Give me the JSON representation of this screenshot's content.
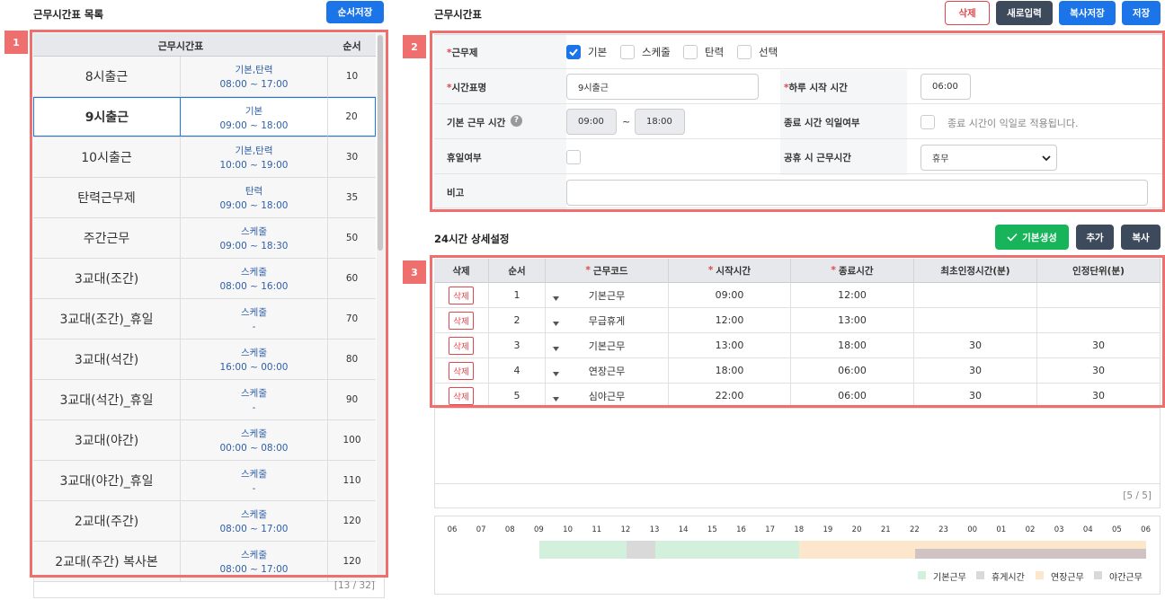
{
  "left": {
    "title": "근무시간표 목록",
    "order_save": "순서저장",
    "badge": "1",
    "headers": {
      "name": "근무시간표",
      "order": "순서"
    },
    "rows": [
      {
        "name": "8시출근",
        "type": "기본,탄력",
        "time": "08:00 ~ 17:00",
        "order": "10"
      },
      {
        "name": "9시출근",
        "type": "기본",
        "time": "09:00 ~ 18:00",
        "order": "20"
      },
      {
        "name": "10시출근",
        "type": "기본,탄력",
        "time": "10:00 ~ 19:00",
        "order": "30"
      },
      {
        "name": "탄력근무제",
        "type": "탄력",
        "time": "09:00 ~ 18:00",
        "order": "35"
      },
      {
        "name": "주간근무",
        "type": "스케줄",
        "time": "09:00 ~ 18:30",
        "order": "50"
      },
      {
        "name": "3교대(조간)",
        "type": "스케줄",
        "time": "08:00 ~ 16:00",
        "order": "60"
      },
      {
        "name": "3교대(조간)_휴일",
        "type": "스케줄",
        "time": "-",
        "order": "70"
      },
      {
        "name": "3교대(석간)",
        "type": "스케줄",
        "time": "16:00 ~ 00:00",
        "order": "80"
      },
      {
        "name": "3교대(석간)_휴일",
        "type": "스케줄",
        "time": "-",
        "order": "90"
      },
      {
        "name": "3교대(야간)",
        "type": "스케줄",
        "time": "00:00 ~ 08:00",
        "order": "100"
      },
      {
        "name": "3교대(야간)_휴일",
        "type": "스케줄",
        "time": "-",
        "order": "110"
      },
      {
        "name": "2교대(주간)",
        "type": "스케줄",
        "time": "08:00 ~ 17:00",
        "order": "120"
      },
      {
        "name": "2교대(주간) 복사본",
        "type": "스케줄",
        "time": "08:00 ~ 17:00",
        "order": "120"
      }
    ],
    "pager": "[13 / 32]"
  },
  "right": {
    "title": "근무시간표",
    "buttons": {
      "delete": "삭제",
      "new": "새로입력",
      "copy_save": "복사저장",
      "save": "저장"
    },
    "badge2": "2",
    "badge3": "3",
    "form": {
      "worktype_label": "근무제",
      "worktype_options": [
        "기본",
        "스케줄",
        "탄력",
        "선택"
      ],
      "name_label": "시간표명",
      "name_value": "9시출근",
      "day_start_label": "하루 시작 시간",
      "day_start_value": "06:00",
      "base_time_label": "기본 근무 시간",
      "help_icon": "?",
      "base_start": "09:00",
      "tilde": "~",
      "base_end": "18:00",
      "next_day_label": "종료 시간 익일여부",
      "next_day_text": "종료 시간이 익일로 적용됩니다.",
      "holiday_label": "휴일여부",
      "public_holiday_label": "공휴 시 근무시간",
      "public_holiday_value": "휴무",
      "note_label": "비고",
      "required_mark": "*"
    },
    "detail": {
      "title": "24시간 상세설정",
      "generate": "기본생성",
      "add": "추가",
      "copy": "복사",
      "headers": [
        "삭제",
        "순서",
        "근무코드",
        "시작시간",
        "종료시간",
        "최초인정시간(분)",
        "인정단위(분)"
      ],
      "rows": [
        {
          "del": "삭제",
          "seq": "1",
          "code": "기본근무",
          "start": "09:00",
          "end": "12:00",
          "first": "",
          "unit": ""
        },
        {
          "del": "삭제",
          "seq": "2",
          "code": "무급휴게",
          "start": "12:00",
          "end": "13:00",
          "first": "",
          "unit": ""
        },
        {
          "del": "삭제",
          "seq": "3",
          "code": "기본근무",
          "start": "13:00",
          "end": "18:00",
          "first": "30",
          "unit": "30"
        },
        {
          "del": "삭제",
          "seq": "4",
          "code": "연장근무",
          "start": "18:00",
          "end": "06:00",
          "first": "30",
          "unit": "30"
        },
        {
          "del": "삭제",
          "seq": "5",
          "code": "심야근무",
          "start": "22:00",
          "end": "06:00",
          "first": "30",
          "unit": "30"
        }
      ],
      "pager": "[5 / 5]"
    },
    "timeline": {
      "hours": [
        "06",
        "07",
        "08",
        "09",
        "10",
        "11",
        "12",
        "13",
        "14",
        "15",
        "16",
        "17",
        "18",
        "19",
        "20",
        "21",
        "22",
        "23",
        "00",
        "01",
        "02",
        "03",
        "04",
        "05",
        "06"
      ],
      "legend": [
        "기본근무",
        "휴게시간",
        "연장근무",
        "야간근무"
      ],
      "colors": {
        "base": "#d3f0dc",
        "rest": "#d9d9d9",
        "overtime": "#fce6cc",
        "night": "#cfc3c3"
      }
    }
  }
}
